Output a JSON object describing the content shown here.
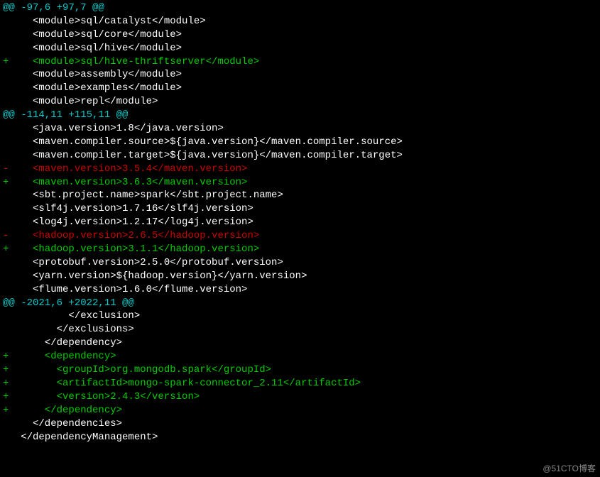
{
  "diff": {
    "lines": [
      {
        "cls": "hunk",
        "text": "@@ -97,6 +97,7 @@"
      },
      {
        "cls": "ctx",
        "text": "     <module>sql/catalyst</module>"
      },
      {
        "cls": "ctx",
        "text": "     <module>sql/core</module>"
      },
      {
        "cls": "ctx",
        "text": "     <module>sql/hive</module>"
      },
      {
        "cls": "add",
        "text": "+    <module>sql/hive-thriftserver</module>"
      },
      {
        "cls": "ctx",
        "text": "     <module>assembly</module>"
      },
      {
        "cls": "ctx",
        "text": "     <module>examples</module>"
      },
      {
        "cls": "ctx",
        "text": "     <module>repl</module>"
      },
      {
        "cls": "hunk",
        "text": "@@ -114,11 +115,11 @@"
      },
      {
        "cls": "ctx",
        "text": "     <java.version>1.8</java.version>"
      },
      {
        "cls": "ctx",
        "text": "     <maven.compiler.source>${java.version}</maven.compiler.source>"
      },
      {
        "cls": "ctx",
        "text": "     <maven.compiler.target>${java.version}</maven.compiler.target>"
      },
      {
        "cls": "del",
        "text": "-    <maven.version>3.5.4</maven.version>"
      },
      {
        "cls": "add",
        "text": "+    <maven.version>3.6.3</maven.version>"
      },
      {
        "cls": "ctx",
        "text": "     <sbt.project.name>spark</sbt.project.name>"
      },
      {
        "cls": "ctx",
        "text": "     <slf4j.version>1.7.16</slf4j.version>"
      },
      {
        "cls": "ctx",
        "text": "     <log4j.version>1.2.17</log4j.version>"
      },
      {
        "cls": "del",
        "text": "-    <hadoop.version>2.6.5</hadoop.version>"
      },
      {
        "cls": "add",
        "text": "+    <hadoop.version>3.1.1</hadoop.version>"
      },
      {
        "cls": "ctx",
        "text": "     <protobuf.version>2.5.0</protobuf.version>"
      },
      {
        "cls": "ctx",
        "text": "     <yarn.version>${hadoop.version}</yarn.version>"
      },
      {
        "cls": "ctx",
        "text": "     <flume.version>1.6.0</flume.version>"
      },
      {
        "cls": "hunk",
        "text": "@@ -2021,6 +2022,11 @@"
      },
      {
        "cls": "ctx",
        "text": "           </exclusion>"
      },
      {
        "cls": "ctx",
        "text": "         </exclusions>"
      },
      {
        "cls": "ctx",
        "text": "       </dependency>"
      },
      {
        "cls": "add",
        "text": "+      <dependency>"
      },
      {
        "cls": "add",
        "text": "+        <groupId>org.mongodb.spark</groupId>"
      },
      {
        "cls": "add",
        "text": "+        <artifactId>mongo-spark-connector_2.11</artifactId>"
      },
      {
        "cls": "add",
        "text": "+        <version>2.4.3</version>"
      },
      {
        "cls": "add",
        "text": "+      </dependency>"
      },
      {
        "cls": "ctx",
        "text": "     </dependencies>"
      },
      {
        "cls": "ctx",
        "text": "   </dependencyManagement>"
      }
    ]
  },
  "watermark": "@51CTO博客"
}
